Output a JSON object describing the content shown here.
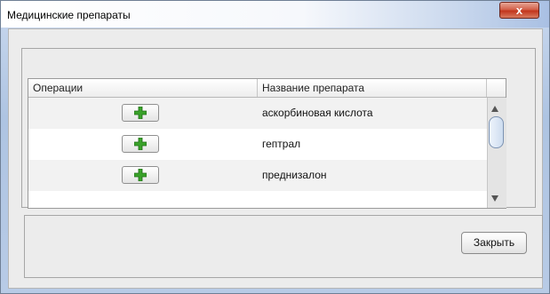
{
  "window": {
    "title": "Медицинские препараты",
    "close_glyph": "x"
  },
  "table": {
    "columns": [
      "Операции",
      "Название препарата"
    ],
    "rows": [
      {
        "name": "аскорбиновая кислота",
        "action_icon": "plus-icon"
      },
      {
        "name": "гептрал",
        "action_icon": "plus-icon"
      },
      {
        "name": "преднизалон",
        "action_icon": "plus-icon"
      }
    ]
  },
  "footer": {
    "close_label": "Закрыть"
  },
  "colors": {
    "plus_icon": "#3aa22a",
    "close_button": "#c2351c"
  }
}
